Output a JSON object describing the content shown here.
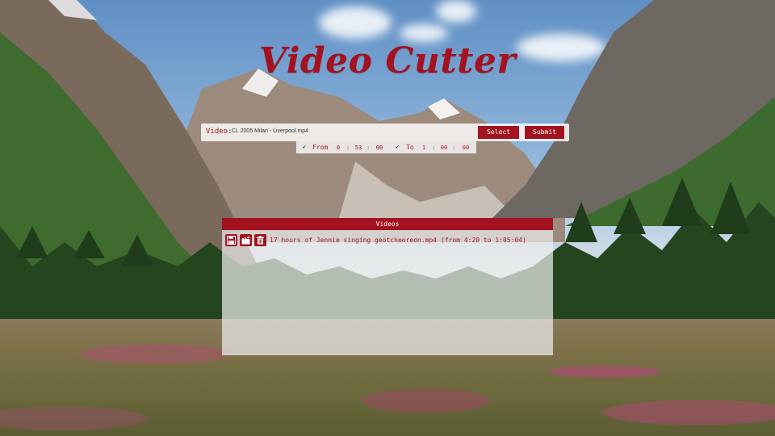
{
  "app": {
    "title": "Video Cutter"
  },
  "form": {
    "video_label": "Video:",
    "video_path": "CL 2005 Milan - Liverpool.mp4",
    "select_label": "Select",
    "submit_label": "Submit"
  },
  "time": {
    "from": {
      "checked": true,
      "label": "From",
      "hours": "0",
      "minutes": "53",
      "seconds": "00"
    },
    "to": {
      "checked": true,
      "label": "To",
      "hours": "1",
      "minutes": "00",
      "seconds": "00"
    },
    "separator": ":"
  },
  "videos": {
    "header": "Videos",
    "items": [
      {
        "text": "17 hours of Jennie singing geotcheoreon.mp4 (from 4:20 to 1:05:04)",
        "icons": [
          "save-icon",
          "clapperboard-icon",
          "trash-icon"
        ]
      }
    ]
  },
  "colors": {
    "accent": "#a3121f",
    "panel": "#ececec"
  }
}
